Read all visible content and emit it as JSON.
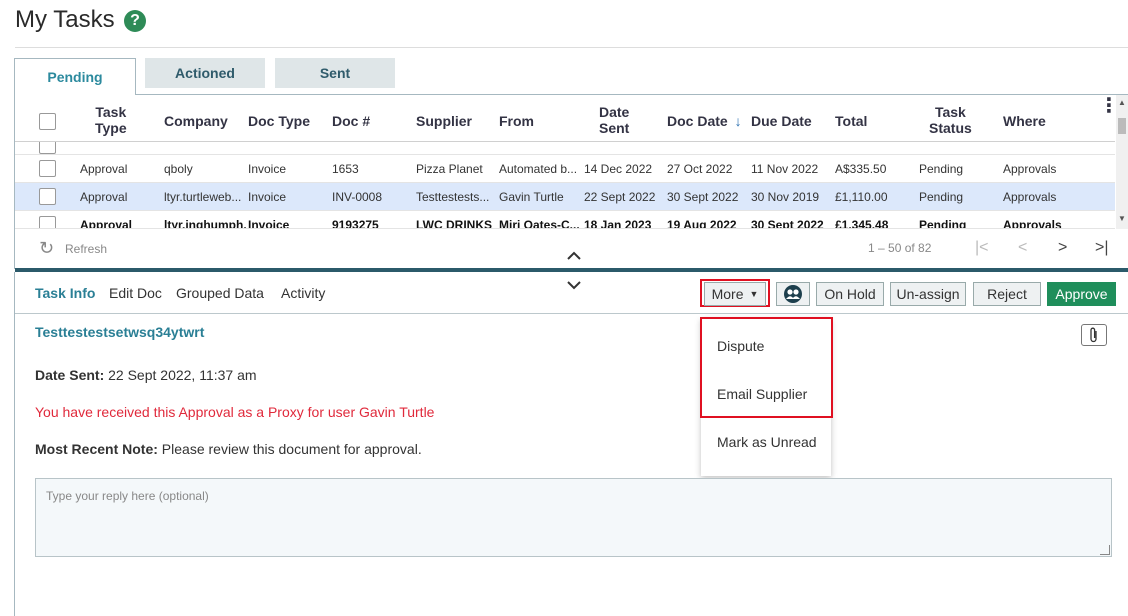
{
  "page": {
    "title": "My Tasks",
    "help_glyph": "?"
  },
  "tabs": [
    "Pending",
    "Actioned",
    "Sent"
  ],
  "grid": {
    "headers": {
      "task_type": [
        "Task",
        "Type"
      ],
      "company": "Company",
      "doc_type": "Doc Type",
      "doc_num": "Doc #",
      "supplier": "Supplier",
      "from": "From",
      "date_sent": [
        "Date",
        "Sent"
      ],
      "doc_date": "Doc Date",
      "sort_arrow": "↓",
      "due_date": "Due Date",
      "total": "Total",
      "task_status": [
        "Task",
        "Status"
      ],
      "where": "Where",
      "menu_glyph": "⋮"
    },
    "rows": [
      {
        "task_type": "Approval",
        "company": "qboly",
        "doc_type": "Invoice",
        "doc_num": "1653",
        "supplier": "Pizza Planet",
        "from": "Automated b...",
        "date_sent": "14 Dec 2022",
        "doc_date": "27 Oct 2022",
        "due_date": "11 Nov 2022",
        "total": "A$335.50",
        "task_status": "Pending",
        "where": "Approvals",
        "bold": false,
        "selected": false
      },
      {
        "task_type": "Approval",
        "company": "ltyr.turtleweb...",
        "doc_type": "Invoice",
        "doc_num": "INV-0008",
        "supplier": "Testtestests...",
        "from": "Gavin Turtle",
        "date_sent": "22 Sept 2022",
        "doc_date": "30 Sept 2022",
        "due_date": "30 Nov 2019",
        "total": "£1,110.00",
        "task_status": "Pending",
        "where": "Approvals",
        "bold": false,
        "selected": true
      },
      {
        "task_type": "Approval",
        "company": "ltyr.inghumph...",
        "doc_type": "Invoice",
        "doc_num": "9193275",
        "supplier": "LWC DRINKS ...",
        "from": "Miri Oates-C...",
        "date_sent": "18 Jan 2023",
        "doc_date": "19 Aug 2022",
        "due_date": "30 Sept 2022",
        "total": "£1,345.48",
        "task_status": "Pending",
        "where": "Approvals",
        "bold": true,
        "selected": false
      }
    ]
  },
  "pager": {
    "refresh_label": "Refresh",
    "range_text": "1 – 50 of 82",
    "first": "|<",
    "prev": "<",
    "next": ">",
    "last": ">|"
  },
  "detail_tabs": [
    "Task Info",
    "Edit Doc",
    "Grouped Data",
    "Activity"
  ],
  "actions": {
    "more_label": "More",
    "on_hold": "On Hold",
    "unassign": "Un-assign",
    "reject": "Reject",
    "approve": "Approve"
  },
  "more_menu": [
    "Dispute",
    "Email Supplier",
    "Mark as Unread"
  ],
  "task_info": {
    "heading": "Testtestestsetwsq34ytwrt",
    "date_sent_label": "Date Sent:",
    "date_sent_value": "22 Sept 2022, 11:37 am",
    "proxy_warning": "You have received this Approval as a Proxy for user Gavin Turtle",
    "note_label": "Most Recent Note:",
    "note_value": "Please review this document for approval.",
    "reply_placeholder": "Type your reply here (optional)"
  },
  "colors": {
    "accent_teal": "#2a7f95",
    "approve_green": "#1f8e5b",
    "warning_red": "#e0293b",
    "highlight_red": "#e01021",
    "selected_row": "#dce8fb"
  }
}
